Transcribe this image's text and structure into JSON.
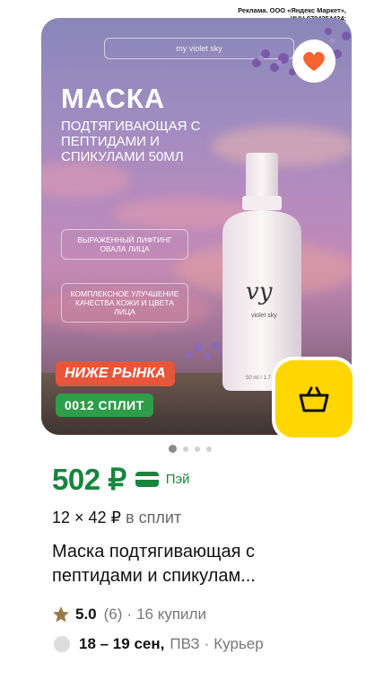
{
  "ad": {
    "line1": "Реклама. ООО «Яндекс Маркет»,",
    "line2": "ИНН 9704254424;"
  },
  "image": {
    "brand_pill": "my violet sky",
    "title": "МАСКА",
    "subtitle": "подтягивающая с пептидами и спикулами 50мл",
    "badge1": "Выраженный лифтинг овала лица",
    "badge2": "Комплексное улучшение качества кожи и цвета лица",
    "bottle_logo": "vy",
    "bottle_brand": "violet sky",
    "bottle_size": "50 ml / 1.7 fl"
  },
  "tags": {
    "market": "НИЖЕ РЫНКА",
    "split": "0012 СПЛИТ"
  },
  "carousel": {
    "total": 4,
    "active": 0
  },
  "price": {
    "value": "502 ₽",
    "pay_label": "Пэй"
  },
  "split": {
    "amount": "12 × 42 ₽",
    "suffix": "в сплит"
  },
  "product": {
    "name": "Маска подтягивающая с пептидами и спикулам..."
  },
  "rating": {
    "score": "5.0",
    "reviews": "(6)",
    "sep": "·",
    "bought": "16 купили"
  },
  "delivery": {
    "dates": "18 – 19 сен,",
    "pickup": "ПВЗ",
    "sep": "·",
    "courier": "Курьер"
  },
  "colors": {
    "price_green": "#16853d",
    "tag_red": "#e8553b",
    "tag_green": "#2e9d4a",
    "cart_yellow": "#ffd600",
    "heart_orange": "#f5632e"
  },
  "icons": {
    "favorite": "heart-icon",
    "cart": "basket-icon",
    "pay": "card-icon",
    "star": "star-icon"
  }
}
